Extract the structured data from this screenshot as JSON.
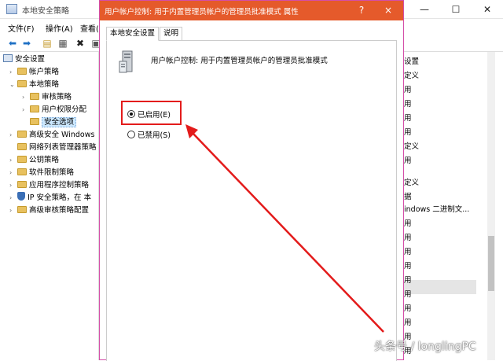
{
  "mmc": {
    "title": "本地安全策略",
    "menu": [
      "文件(F)",
      "操作(A)",
      "查看("
    ],
    "tree": [
      {
        "label": "安全设置"
      },
      {
        "label": "帐户策略"
      },
      {
        "label": "本地策略"
      },
      {
        "label": "审核策略"
      },
      {
        "label": "用户权限分配"
      },
      {
        "label": "安全选项"
      },
      {
        "label": "高级安全 Windows"
      },
      {
        "label": "网络列表管理器策略"
      },
      {
        "label": "公钥策略"
      },
      {
        "label": "软件限制策略"
      },
      {
        "label": "应用程序控制策略"
      },
      {
        "label": "IP 安全策略，在 本"
      },
      {
        "label": "高级审核策略配置"
      }
    ],
    "right_pane": [
      "设置",
      "定义",
      "用",
      "用",
      "用",
      "用",
      "定义",
      "用",
      "定义",
      "据",
      "indows 二进制文...",
      "用",
      "用",
      "用",
      "用",
      "用",
      "用",
      "用",
      "用",
      "用",
      "用",
      "用"
    ]
  },
  "dialog": {
    "title": "用户帐户控制: 用于内置管理员帐户的管理员批准模式 属性",
    "help": "?",
    "close": "×",
    "tabs": [
      "本地安全设置",
      "说明"
    ],
    "policy_name": "用户帐户控制: 用于内置管理员帐户的管理员批准模式",
    "options": [
      {
        "label": "已启用(E)",
        "checked": true
      },
      {
        "label": "已禁用(S)",
        "checked": false
      }
    ]
  },
  "watermark": "头条号 / longlingPC",
  "colors": {
    "dialog_title_bg": "#e55a2b",
    "annotation_red": "#e31b1b",
    "accent_border": "#d44da8"
  }
}
